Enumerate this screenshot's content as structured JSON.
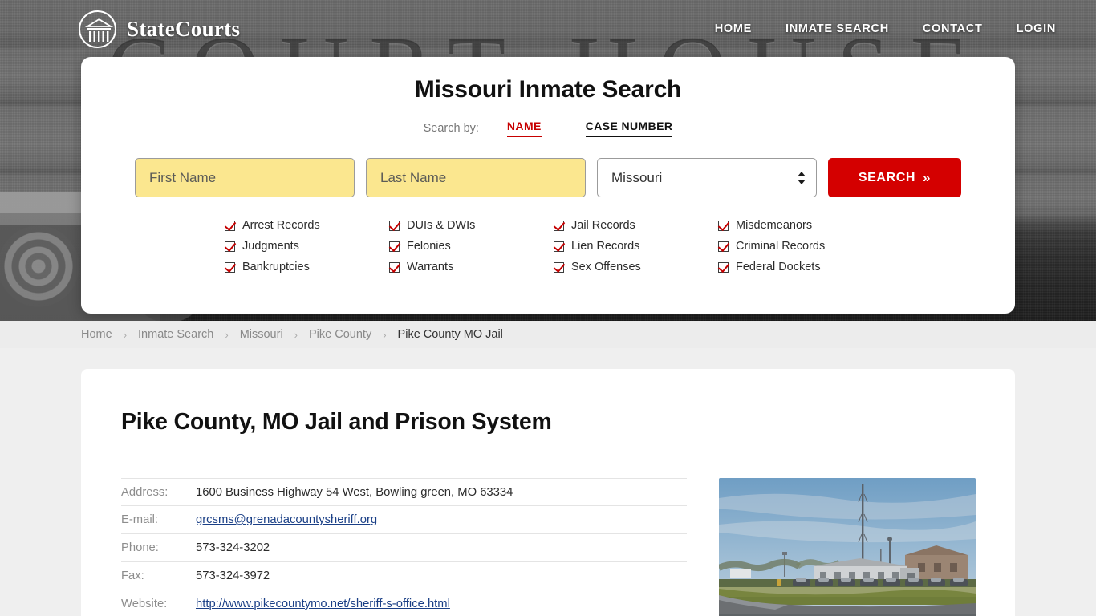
{
  "header": {
    "brand_name": "StateCourts",
    "logo_icon": "courthouse-circle-icon",
    "nav": [
      {
        "label": "HOME"
      },
      {
        "label": "INMATE SEARCH"
      },
      {
        "label": "CONTACT"
      },
      {
        "label": "LOGIN"
      }
    ],
    "background_text": "COURT HOUSE"
  },
  "search": {
    "title": "Missouri Inmate Search",
    "search_by_label": "Search by:",
    "tabs": [
      {
        "label": "NAME",
        "active": true,
        "color": "#c70000"
      },
      {
        "label": "CASE NUMBER",
        "active": false,
        "color": "#111111"
      }
    ],
    "first_name_placeholder": "First Name",
    "first_name_value": "",
    "last_name_placeholder": "Last Name",
    "last_name_value": "",
    "state_selected": "Missouri",
    "state_options": [
      "Missouri"
    ],
    "button_label": "SEARCH",
    "button_chevron": "»",
    "button_color": "#d40000",
    "input_color": "#fbe78f",
    "checkboxes": [
      "Arrest Records",
      "DUIs & DWIs",
      "Jail Records",
      "Misdemeanors",
      "Judgments",
      "Felonies",
      "Lien Records",
      "Criminal Records",
      "Bankruptcies",
      "Warrants",
      "Sex Offenses",
      "Federal Dockets"
    ]
  },
  "breadcrumb": {
    "separator": "›",
    "items": [
      {
        "label": "Home",
        "current": false
      },
      {
        "label": "Inmate Search",
        "current": false
      },
      {
        "label": "Missouri",
        "current": false
      },
      {
        "label": "Pike County",
        "current": false
      },
      {
        "label": "Pike County MO Jail",
        "current": true
      }
    ]
  },
  "main": {
    "page_title": "Pike County, MO Jail and Prison System",
    "details": [
      {
        "label": "Address:",
        "value": "1600 Business Highway 54 West, Bowling green, MO 63334",
        "is_link": false
      },
      {
        "label": "E-mail:",
        "value": "grcsms@grenadacountysheriff.org",
        "is_link": true
      },
      {
        "label": "Phone:",
        "value": "573-324-3202",
        "is_link": false
      },
      {
        "label": "Fax:",
        "value": "573-324-3972",
        "is_link": false
      },
      {
        "label": "Website:",
        "value": "http://www.pikecountymo.net/sheriff-s-office.html",
        "is_link": true
      }
    ],
    "photo_alt": "Pike County MO Jail building exterior with parking lot and radio tower"
  }
}
